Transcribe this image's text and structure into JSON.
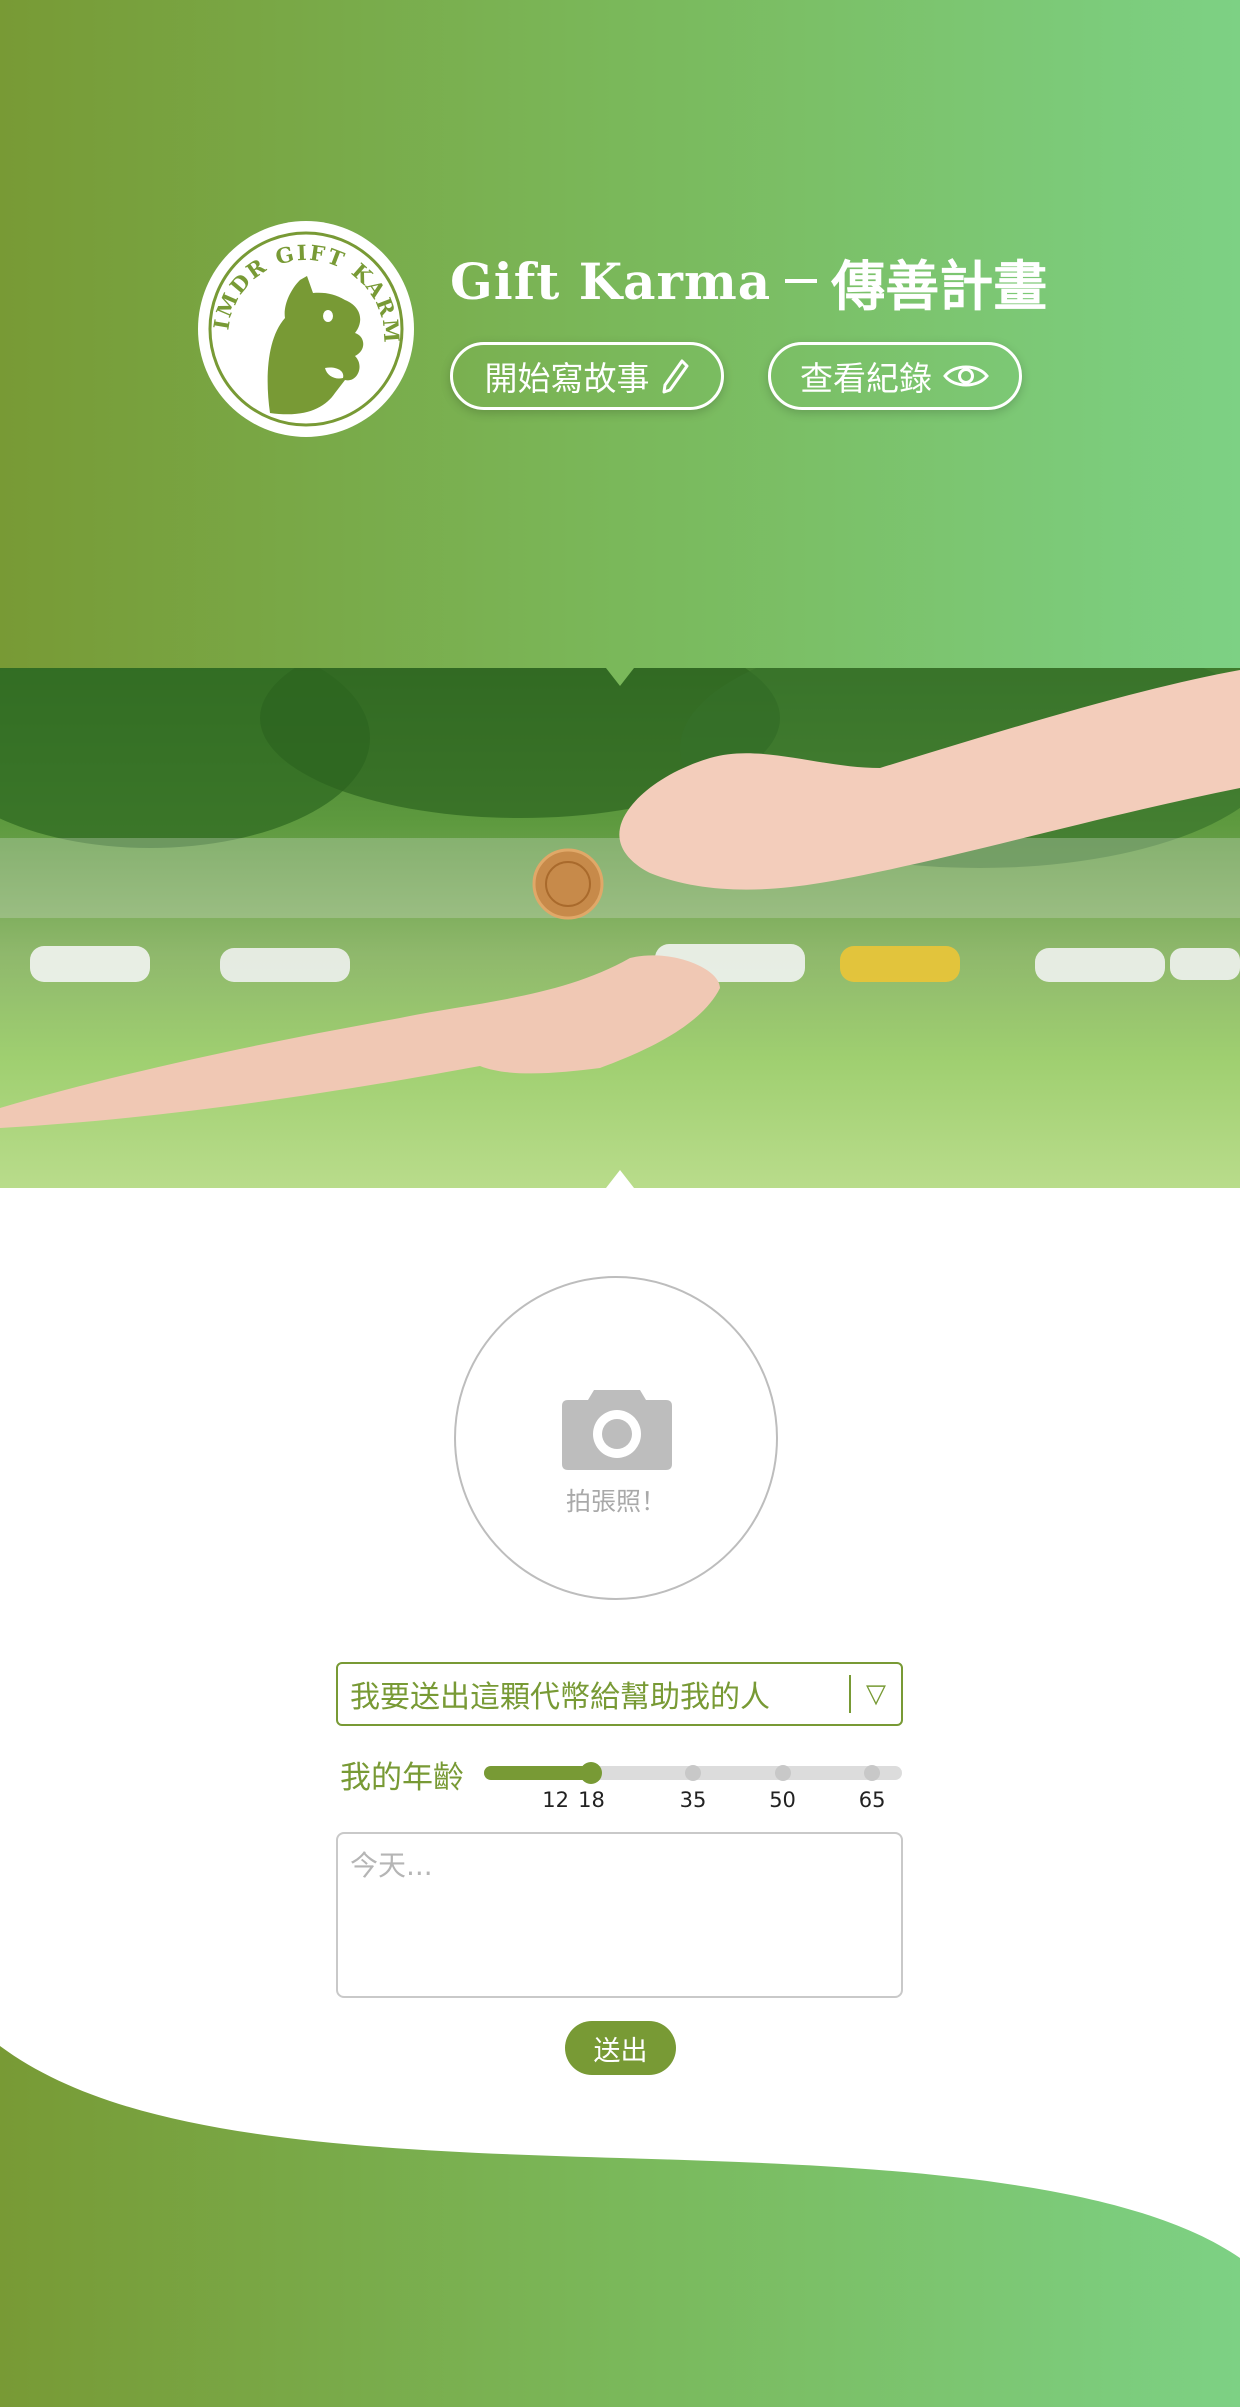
{
  "colors": {
    "brand_green": "#789a35",
    "gradient_light": "#7dd184",
    "white": "#ffffff",
    "track_gray": "#dcdcdc",
    "border_gray": "#c9c9c9"
  },
  "header": {
    "logo": {
      "icon": "imdr-gift-karma-logo",
      "ring_text": "IMDR GIFT KARMA"
    },
    "title_en": "Gift Karma",
    "title_zh": "傳善計畫",
    "write_button": {
      "label": "開始寫故事",
      "icon": "pencil-icon"
    },
    "view_button": {
      "label": "查看紀錄",
      "icon": "eye-icon"
    }
  },
  "hero": {
    "image": "hand-giving-coin-to-open-palm-park-background"
  },
  "photo": {
    "icon": "camera-icon",
    "label": "拍張照！"
  },
  "form": {
    "purpose_select": {
      "selected": "我要送出這顆代幣給幫助我的人",
      "arrow": "▽"
    },
    "age": {
      "label": "我的年齡",
      "ticks": [
        "12",
        "18",
        "35",
        "50",
        "65"
      ],
      "selected": "18"
    },
    "story": {
      "placeholder": "今天..."
    },
    "submit_label": "送出"
  }
}
